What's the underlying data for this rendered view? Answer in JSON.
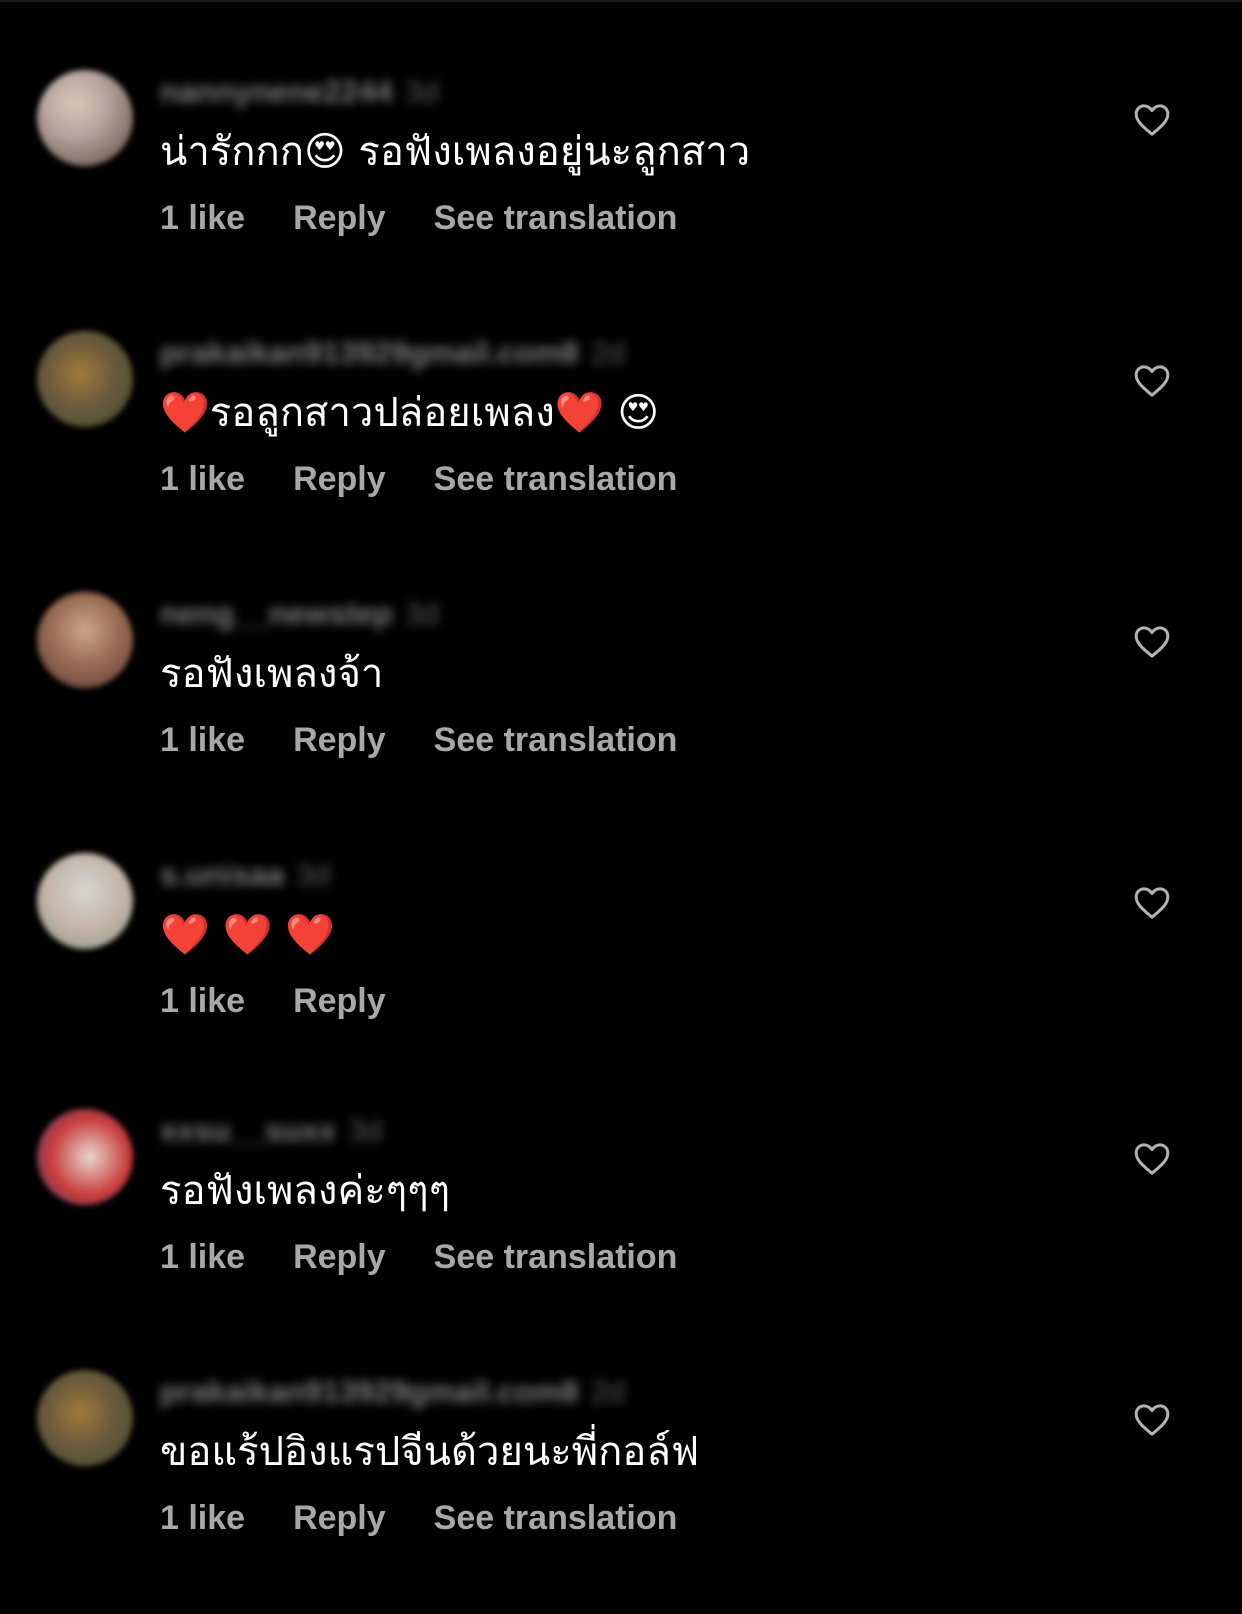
{
  "comments": [
    {
      "username": "nannynene2244",
      "time": "3d",
      "text": "น่ารักกก😍 รอฟังเพลงอยู่นะลูกสาว",
      "likes": "1 like",
      "reply": "Reply",
      "translate": "See translation",
      "avatar_colors": [
        "#b9a7a1",
        "#5d4a3e",
        "#d8c7b5"
      ]
    },
    {
      "username": "prakaikan913929gmail.com8",
      "time": "2d",
      "text": "❤️รอลูกสาวปล่อยเพลง❤️ 😍",
      "likes": "1 like",
      "reply": "Reply",
      "translate": "See translation",
      "avatar_colors": [
        "#6b5a3c",
        "#a07a3a",
        "#3e4a2e"
      ]
    },
    {
      "username": "neng__newstep",
      "time": "3d",
      "text": "รอฟังเพลงจ้า",
      "likes": "1 like",
      "reply": "Reply",
      "translate": "See translation",
      "avatar_colors": [
        "#9a6c55",
        "#c9a78c",
        "#5a3c34"
      ]
    },
    {
      "username": "s.unisaa",
      "time": "3d",
      "text": "❤️ ❤️ ❤️",
      "likes": "1 like",
      "reply": "Reply",
      "translate": "",
      "avatar_colors": [
        "#d5d6d2",
        "#8a9a8c",
        "#c4b4a6"
      ]
    },
    {
      "username": "xxsu__suxx",
      "time": "3d",
      "text": "รอฟังเพลงค่ะๆๆๆ",
      "likes": "1 like",
      "reply": "Reply",
      "translate": "See translation",
      "avatar_colors": [
        "#c83a3a",
        "#e8d8d0",
        "#3a4a7a"
      ]
    },
    {
      "username": "prakaikan913929gmail.com8",
      "time": "2d",
      "text": "ขอแร้ปอิงแรปจีนด้วยนะพี่กอล์ฟ",
      "likes": "1 like",
      "reply": "Reply",
      "translate": "See translation",
      "avatar_colors": [
        "#6b5a3c",
        "#a07a3a",
        "#3e4a2e"
      ]
    }
  ],
  "icons": {
    "like": "heart-outline-icon"
  },
  "colors": {
    "background": "#000000",
    "text": "#ffffff",
    "secondary": "#a8a8a8",
    "username": "#7d7d7d"
  }
}
